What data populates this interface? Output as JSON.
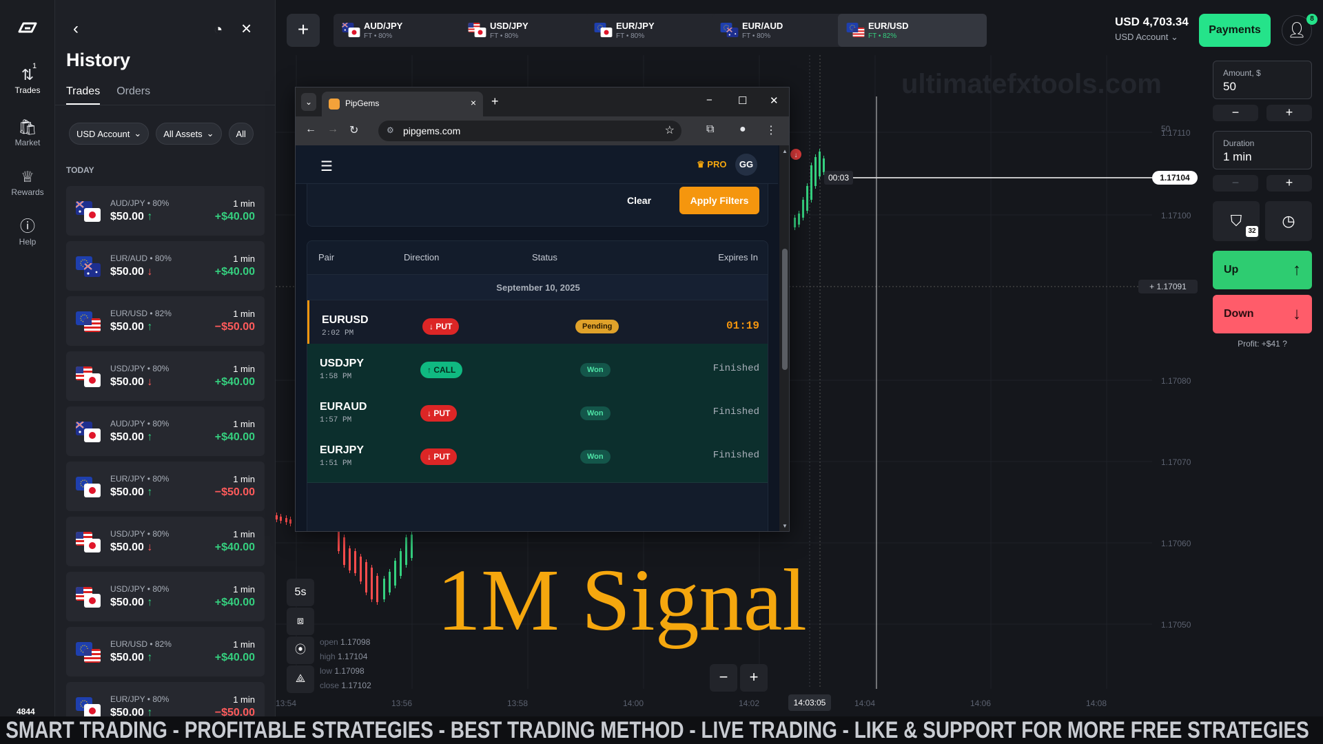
{
  "nav": {
    "items": [
      {
        "label": "Trades",
        "icon": "trades-icon"
      },
      {
        "label": "Market",
        "icon": "market-icon"
      },
      {
        "label": "Rewards",
        "icon": "trophy-icon"
      },
      {
        "label": "Help",
        "icon": "help-icon"
      }
    ],
    "trades_badge": "1",
    "bottom_number": "4844"
  },
  "history": {
    "title": "History",
    "tabs": [
      "Trades",
      "Orders"
    ],
    "filters": [
      "USD Account",
      "All Assets",
      "All"
    ],
    "section": "TODAY",
    "trades": [
      {
        "pair": "AUD/JPY • 80%",
        "amount": "$50.00",
        "dir": "up",
        "duration": "1 min",
        "profit": "+$40.00",
        "f1": "au",
        "f2": "jp"
      },
      {
        "pair": "EUR/AUD • 80%",
        "amount": "$50.00",
        "dir": "down",
        "duration": "1 min",
        "profit": "+$40.00",
        "f1": "eu",
        "f2": "au"
      },
      {
        "pair": "EUR/USD • 82%",
        "amount": "$50.00",
        "dir": "up",
        "duration": "1 min",
        "profit": "−$50.00",
        "f1": "eu",
        "f2": "us"
      },
      {
        "pair": "USD/JPY • 80%",
        "amount": "$50.00",
        "dir": "down",
        "duration": "1 min",
        "profit": "+$40.00",
        "f1": "us",
        "f2": "jp"
      },
      {
        "pair": "AUD/JPY • 80%",
        "amount": "$50.00",
        "dir": "up",
        "duration": "1 min",
        "profit": "+$40.00",
        "f1": "au",
        "f2": "jp"
      },
      {
        "pair": "EUR/JPY • 80%",
        "amount": "$50.00",
        "dir": "up",
        "duration": "1 min",
        "profit": "−$50.00",
        "f1": "eu",
        "f2": "jp"
      },
      {
        "pair": "USD/JPY • 80%",
        "amount": "$50.00",
        "dir": "down",
        "duration": "1 min",
        "profit": "+$40.00",
        "f1": "us",
        "f2": "jp"
      },
      {
        "pair": "USD/JPY • 80%",
        "amount": "$50.00",
        "dir": "up",
        "duration": "1 min",
        "profit": "+$40.00",
        "f1": "us",
        "f2": "jp"
      },
      {
        "pair": "EUR/USD • 82%",
        "amount": "$50.00",
        "dir": "up",
        "duration": "1 min",
        "profit": "+$40.00",
        "f1": "eu",
        "f2": "us"
      },
      {
        "pair": "EUR/JPY • 80%",
        "amount": "$50.00",
        "dir": "up",
        "duration": "1 min",
        "profit": "−$50.00",
        "f1": "eu",
        "f2": "jp"
      }
    ]
  },
  "topbar": {
    "assets": [
      {
        "name": "AUD/JPY",
        "sub": "FT • 80%",
        "f1": "au",
        "f2": "jp"
      },
      {
        "name": "USD/JPY",
        "sub": "FT • 80%",
        "f1": "us",
        "f2": "jp"
      },
      {
        "name": "EUR/JPY",
        "sub": "FT • 80%",
        "f1": "eu",
        "f2": "jp"
      },
      {
        "name": "EUR/AUD",
        "sub": "FT • 80%",
        "f1": "eu",
        "f2": "au"
      },
      {
        "name": "EUR/USD",
        "sub": "FT • 82%",
        "f1": "eu",
        "f2": "us"
      }
    ],
    "active_index": 4,
    "balance": "USD 4,703.34",
    "account": "USD Account",
    "payments": "Payments",
    "user_badge": "8"
  },
  "chart": {
    "watermark": "ultimatefxtools.com",
    "price_labels": [
      "1.17110",
      "1.17100",
      "1.17080",
      "1.17070",
      "1.17060",
      "1.17050"
    ],
    "current_price": "1.17104",
    "cross_price": "1.17091",
    "top_partial": "50",
    "timer": "00:03",
    "time_labels": [
      "13:54",
      "13:56",
      "13:58",
      "14:00",
      "14:02",
      "14:04",
      "14:06",
      "14:08"
    ],
    "cross_time": "14:03:05",
    "timeframe": "5s",
    "ohlc": {
      "open": "1.17098",
      "high": "1.17104",
      "low": "1.17098",
      "close": "1.17102"
    },
    "overlay_title": "1M Signal"
  },
  "panel": {
    "amount_label": "Amount, $",
    "amount": "50",
    "duration_label": "Duration",
    "duration": "1 min",
    "shield_badge": "32",
    "up": "Up",
    "down": "Down",
    "profit": "Profit: +$41"
  },
  "browser": {
    "tab_title": "PipGems",
    "url": "pipgems.com",
    "pro": "PRO",
    "avatar": "GG",
    "clear": "Clear",
    "apply": "Apply Filters",
    "headers": [
      "Pair",
      "Direction",
      "Status",
      "Expires In"
    ],
    "date": "September 10, 2025",
    "signals": [
      {
        "pair": "EURUSD",
        "time": "2:02 PM",
        "dir": "PUT",
        "status": "Pending",
        "expires": "01:19"
      },
      {
        "pair": "USDJPY",
        "time": "1:58 PM",
        "dir": "CALL",
        "status": "Won",
        "expires": "Finished"
      },
      {
        "pair": "EURAUD",
        "time": "1:57 PM",
        "dir": "PUT",
        "status": "Won",
        "expires": "Finished"
      },
      {
        "pair": "EURJPY",
        "time": "1:51 PM",
        "dir": "PUT",
        "status": "Won",
        "expires": "Finished"
      }
    ]
  },
  "ticker": "SMART TRADING - PROFITABLE STRATEGIES - BEST TRADING METHOD - LIVE TRADING - LIKE & SUPPORT FOR MORE FREE STRATEGIES",
  "colors": {
    "accent_green": "#25e38a",
    "up_button": "#2ecc71",
    "down_button": "#ff5c6a",
    "signal_orange": "#f5a70e"
  }
}
